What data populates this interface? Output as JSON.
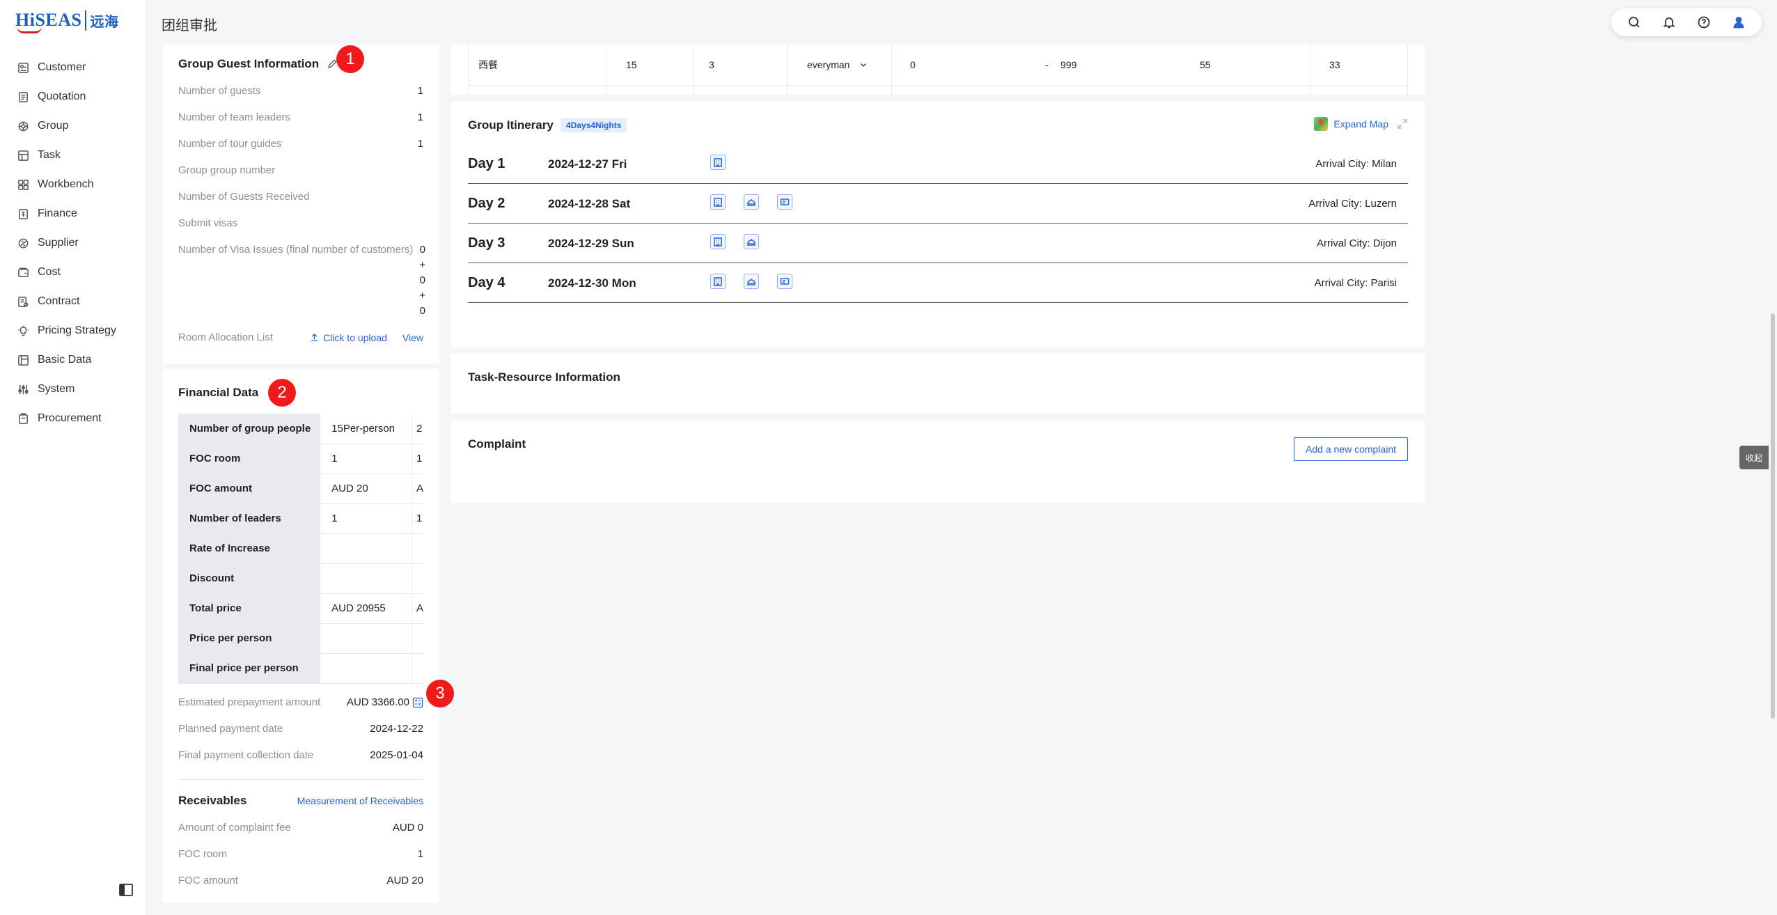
{
  "logo": {
    "text": "HiSEAS",
    "cn": "远海"
  },
  "sidebar": {
    "items": [
      {
        "label": "Customer",
        "icon": "customer-icon"
      },
      {
        "label": "Quotation",
        "icon": "quotation-icon"
      },
      {
        "label": "Group",
        "icon": "group-icon"
      },
      {
        "label": "Task",
        "icon": "task-icon"
      },
      {
        "label": "Workbench",
        "icon": "workbench-icon"
      },
      {
        "label": "Finance",
        "icon": "finance-icon"
      },
      {
        "label": "Supplier",
        "icon": "supplier-icon"
      },
      {
        "label": "Cost",
        "icon": "cost-icon"
      },
      {
        "label": "Contract",
        "icon": "contract-icon"
      },
      {
        "label": "Pricing Strategy",
        "icon": "bulb-icon"
      },
      {
        "label": "Basic Data",
        "icon": "basic-data-icon"
      },
      {
        "label": "System",
        "icon": "sliders-icon"
      },
      {
        "label": "Procurement",
        "icon": "procurement-icon"
      }
    ]
  },
  "header": {
    "title": "团组审批"
  },
  "guest_info": {
    "title": "Group Guest Information",
    "badge": "1",
    "rows": [
      {
        "k": "Number of guests",
        "v": "1"
      },
      {
        "k": "Number of team leaders",
        "v": "1"
      },
      {
        "k": "Number of tour guides",
        "v": "1"
      },
      {
        "k": "Group group number",
        "v": ""
      },
      {
        "k": "Number of Guests Received",
        "v": ""
      },
      {
        "k": "Submit visas",
        "v": ""
      }
    ],
    "visa_issues_label": "Number of Visa Issues (final number of customers)",
    "visa_issues_lines": [
      "0",
      "+",
      "0",
      "+",
      "0"
    ],
    "room_label": "Room Allocation List",
    "upload_label": "Click to upload",
    "view_label": "View"
  },
  "financial": {
    "title": "Financial Data",
    "badge": "2",
    "table": [
      {
        "h": "Number of group people",
        "c1": "15Per-person",
        "c2": "2"
      },
      {
        "h": "FOC room",
        "c1": "1",
        "c2": "1"
      },
      {
        "h": "FOC amount",
        "c1": "AUD 20",
        "c2": "A"
      },
      {
        "h": "Number of leaders",
        "c1": "1",
        "c2": "1"
      },
      {
        "h": "Rate of Increase",
        "c1": "",
        "c2": ""
      },
      {
        "h": "Discount",
        "c1": "",
        "c2": ""
      },
      {
        "h": "Total price",
        "c1": "AUD 20955",
        "c2": "A"
      },
      {
        "h": "Price per person",
        "c1": "",
        "c2": ""
      },
      {
        "h": "Final price per person",
        "c1": "",
        "c2": ""
      }
    ],
    "prepay_label": "Estimated prepayment amount",
    "prepay_value": "AUD 3366.00",
    "badge3": "3",
    "planned_label": "Planned payment date",
    "planned_value": "2024-12-22",
    "final_label": "Final payment collection date",
    "final_value": "2025-01-04",
    "receivables_title": "Receivables",
    "measurement_link": "Measurement of Receivables",
    "recv_rows": [
      {
        "k": "Amount of complaint fee",
        "v": "AUD 0"
      },
      {
        "k": "FOC room",
        "v": "1"
      },
      {
        "k": "FOC amount",
        "v": "AUD 20"
      }
    ]
  },
  "top_row": {
    "name": "西餐",
    "c2": "15",
    "c3": "3",
    "select": "everyman",
    "c5": "0",
    "dash": "-",
    "c6": "999",
    "c7": "55",
    "c8": "33"
  },
  "itinerary": {
    "title": "Group Itinerary",
    "days_badge": "4Days4Nights",
    "expand_map": "Expand Map",
    "days": [
      {
        "label": "Day 1",
        "date": "2024-12-27 Fri",
        "city": "Arrival City:  Milan",
        "icons": [
          "hotel-icon"
        ]
      },
      {
        "label": "Day 2",
        "date": "2024-12-28 Sat",
        "city": "Arrival City:  Luzern",
        "icons": [
          "hotel-icon",
          "meal-icon",
          "ticket-icon"
        ]
      },
      {
        "label": "Day 3",
        "date": "2024-12-29 Sun",
        "city": "Arrival City:  Dijon",
        "icons": [
          "hotel-icon",
          "meal-icon"
        ]
      },
      {
        "label": "Day 4",
        "date": "2024-12-30 Mon",
        "city": "Arrival City:  Parisi",
        "icons": [
          "hotel-icon",
          "meal-icon",
          "ticket-icon"
        ]
      }
    ]
  },
  "task_resource": {
    "title": "Task-Resource Information"
  },
  "complaint": {
    "title": "Complaint",
    "add_label": "Add a new complaint"
  },
  "side_tag": "收起"
}
